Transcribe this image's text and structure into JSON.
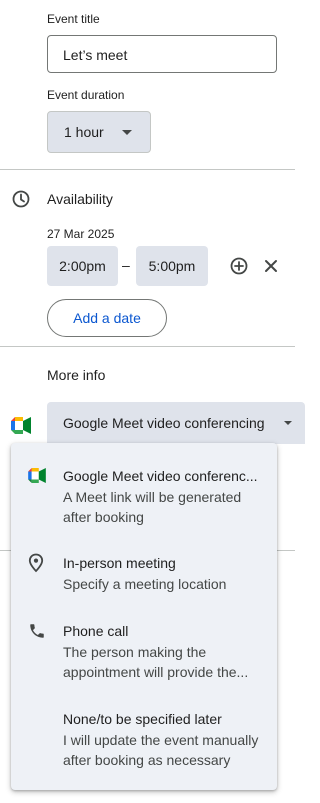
{
  "form": {
    "event_title_label": "Event title",
    "event_title_value": "Let’s meet",
    "duration_label": "Event duration",
    "duration_value": "1 hour"
  },
  "availability": {
    "title": "Availability",
    "date": "27 Mar 2025",
    "start_time": "2:00pm",
    "separator": "–",
    "end_time": "5:00pm",
    "add_date_label": "Add a date",
    "icons": [
      "clock-icon",
      "add-circle-icon",
      "close-icon"
    ]
  },
  "more_info": {
    "title": "More info",
    "conference_selected": "Google Meet video conferencing",
    "options": [
      {
        "title": "Google Meet video conferenc...",
        "desc": "A Meet link will be generated after booking",
        "icon": "google-meet-icon"
      },
      {
        "title": "In-person meeting",
        "desc": "Specify a meeting location",
        "icon": "location-pin-icon"
      },
      {
        "title": "Phone call",
        "desc": "The person making the appointment will provide the...",
        "icon": "phone-icon"
      },
      {
        "title": "None/to be specified later",
        "desc": "I will update the event manually after booking as necessary",
        "icon": ""
      }
    ]
  },
  "colors": {
    "accent": "#0b57d0",
    "chip_bg": "#dfe3eb",
    "menu_bg": "#eef1f6"
  }
}
